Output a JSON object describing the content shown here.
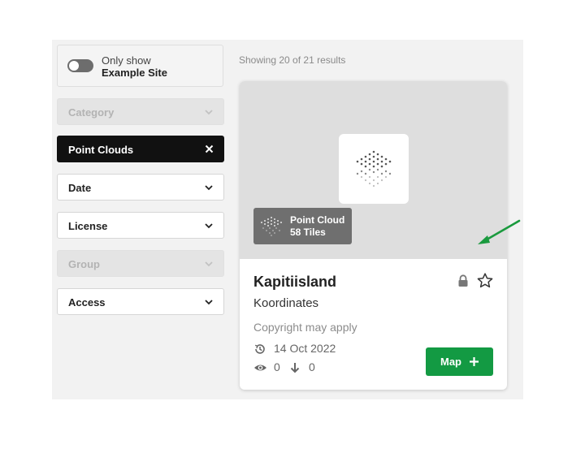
{
  "toggle": {
    "line1": "Only show",
    "line2": "Example Site",
    "on": false
  },
  "filters": [
    {
      "label": "Category",
      "state": "disabled"
    },
    {
      "label": "Point Clouds",
      "state": "active"
    },
    {
      "label": "Date",
      "state": "normal"
    },
    {
      "label": "License",
      "state": "normal"
    },
    {
      "label": "Group",
      "state": "disabled"
    },
    {
      "label": "Access",
      "state": "normal"
    }
  ],
  "results": {
    "summary": "Showing 20 of 21 results"
  },
  "card": {
    "badge_type": "Point Cloud",
    "badge_count": "58 Tiles",
    "title": "Kapitiisland",
    "subtitle": "Koordinates",
    "copyright": "Copyright may apply",
    "date": "14 Oct 2022",
    "views": "0",
    "downloads": "0",
    "map_button": "Map"
  },
  "icons": {
    "toggle": "toggle-switch-icon",
    "chevron": "chevron-down-icon",
    "clear": "close-icon",
    "pointcloud": "point-cloud-icon",
    "lock": "lock-icon",
    "star": "star-outline-icon",
    "history": "history-icon",
    "eye": "eye-icon",
    "download": "arrow-down-icon",
    "plus": "plus-icon",
    "annotation": "annotation-arrow-icon"
  },
  "colors": {
    "accent_green": "#139a43",
    "active_filter": "#111111",
    "annotation": "#1a9a3e"
  }
}
